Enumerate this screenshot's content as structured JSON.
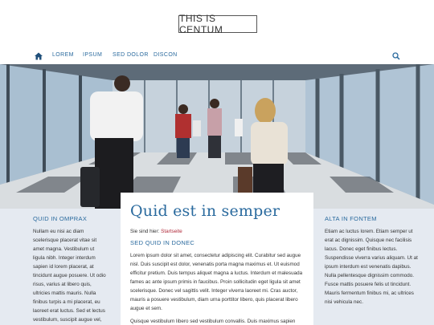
{
  "header": {
    "logo": "THIS IS CENTUM"
  },
  "nav": {
    "items": [
      {
        "label": "LOREM"
      },
      {
        "label": "IPSUM"
      },
      {
        "label": "SED DOLOR"
      },
      {
        "label": "DISCON"
      }
    ]
  },
  "left": {
    "title": "QUID IN OMPRAX",
    "text": "Nullam eu nisi ac diam scelerisque placerat vitae sit amet magna. Vestibulum ut ligula nibh. Integer interdum sapien id lorem placerat, at tincidunt augue posuere. Ut odio risus, varius at libero quis, ultricies mattis mauris. Nulla finibus turpis a mi placerat, eu laoreet erat luctus. Sed et lectus vestibulum, suscipit augue vel, lobortis felis. Nulla a"
  },
  "main": {
    "title": "Quid est in semper",
    "breadcrumb_prefix": "Sie sind hier:",
    "breadcrumb_link": "Startseite",
    "subtitle": "SED QUID IN DONEC",
    "para1": "Lorem ipsum dolor sit amet, consectetur adipiscing elit. Curabitur sed augue nisl. Duis suscipit est dolor, venenatis porta magna maximus et. Ut euismod efficitur pretium. Duis tempus aliquet magna a luctus. Interdum et malesuada fames ac ante ipsum primis in faucibus. Proin sollicitudin eget ligula sit amet scelerisque. Donec vel sagittis velit. Integer viverra laoreet mi. Cras auctor, mauris a posuere vestibulum, diam urna porttitor libero, quis placerat libero augue et sem.",
    "para2": "Quisque vestibulum libero sed vestibulum convallis. Duis maximus sapien"
  },
  "right": {
    "title": "ALTA IN FONTEM",
    "text": "Etiam ac luctus lorem. Etiam semper ut erat ac dignissim. Quisque nec facilisis lacus. Donec eget finibus lectus. Suspendisse viverra varius aliquam. Ut at ipsum interdum est venenatis dapibus. Nulla pellentesque dignissim commodo. Fusce mattis posuere felis ut tincidunt. Mauris fermentum finibus mi, ac ultrices nisi vehicula nec."
  }
}
